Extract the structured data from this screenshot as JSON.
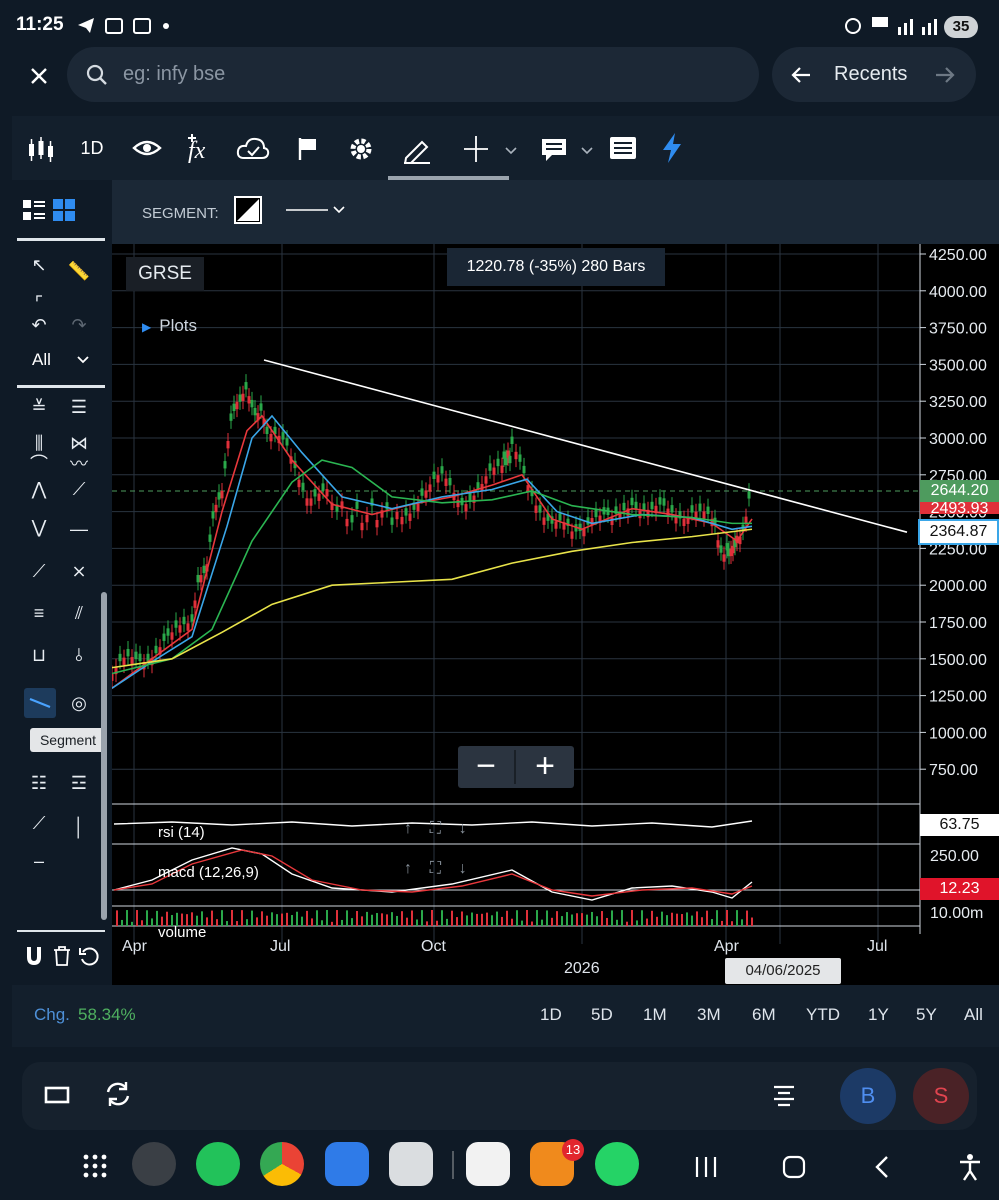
{
  "status_bar": {
    "time": "11:25",
    "battery": "35"
  },
  "search": {
    "placeholder": "eg: infy bse",
    "recents_label": "Recents"
  },
  "toolbar": {
    "interval_label": "1D"
  },
  "segment_bar": {
    "label": "SEGMENT:"
  },
  "left_panel": {
    "filter_label": "All",
    "tooltip": "Segment"
  },
  "chart": {
    "symbol": "GRSE",
    "plots_label": "Plots",
    "measure_label": "1220.78 (-35%) 280 Bars",
    "price_axis": [
      "4250.00",
      "4000.00",
      "3750.00",
      "3500.00",
      "3250.00",
      "3000.00",
      "2750.00",
      "2500.00",
      "2250.00",
      "2000.00",
      "1750.00",
      "1500.00",
      "1250.00",
      "1000.00",
      "750.00"
    ],
    "price_tags": {
      "last": "2644.20",
      "hidden": "2493.93",
      "trendline": "2364.87"
    },
    "indicators": {
      "rsi": {
        "label": "rsi (14)",
        "value": "63.75"
      },
      "macd": {
        "label": "macd (12,26,9)",
        "value": "12.23",
        "axis_label": "250.00"
      },
      "volume": {
        "label": "volume",
        "axis_label": "10.00m"
      }
    },
    "time_axis": [
      "Apr",
      "Jul",
      "Oct",
      "2026",
      "Apr",
      "Jul"
    ],
    "crosshair_date": "04/06/2025",
    "colors": {
      "up": "#2aa84a",
      "down": "#e0303a",
      "ema_fast": "#e8383c",
      "ema_mid": "#3aa6e8",
      "ema_slow": "#2bb552",
      "sma_long": "#e8e34a",
      "trendline": "#ffffff"
    }
  },
  "change_row": {
    "label": "Chg.",
    "value": "58.34%",
    "ranges": [
      "1D",
      "5D",
      "1M",
      "3M",
      "6M",
      "YTD",
      "1Y",
      "5Y",
      "All"
    ]
  },
  "bottom_bar": {
    "buy_label": "B",
    "sell_label": "S"
  },
  "dock": {
    "notification_badge": "13"
  }
}
